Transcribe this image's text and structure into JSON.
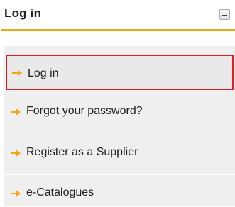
{
  "panel": {
    "title": "Log in",
    "accent_color": "#f2a615",
    "collapse_icon": "minus-icon"
  },
  "menu": {
    "items": [
      {
        "label": "Log in",
        "icon": "arrow-right-icon",
        "selected": true
      },
      {
        "label": "Forgot your password?",
        "icon": "arrow-right-icon",
        "selected": false
      },
      {
        "label": "Register as a Supplier",
        "icon": "arrow-right-icon",
        "selected": false
      },
      {
        "label": "e-Catalogues",
        "icon": "arrow-right-icon",
        "selected": false
      }
    ],
    "arrow_color": "#f2a615",
    "selection_border_color": "#e51c23"
  }
}
